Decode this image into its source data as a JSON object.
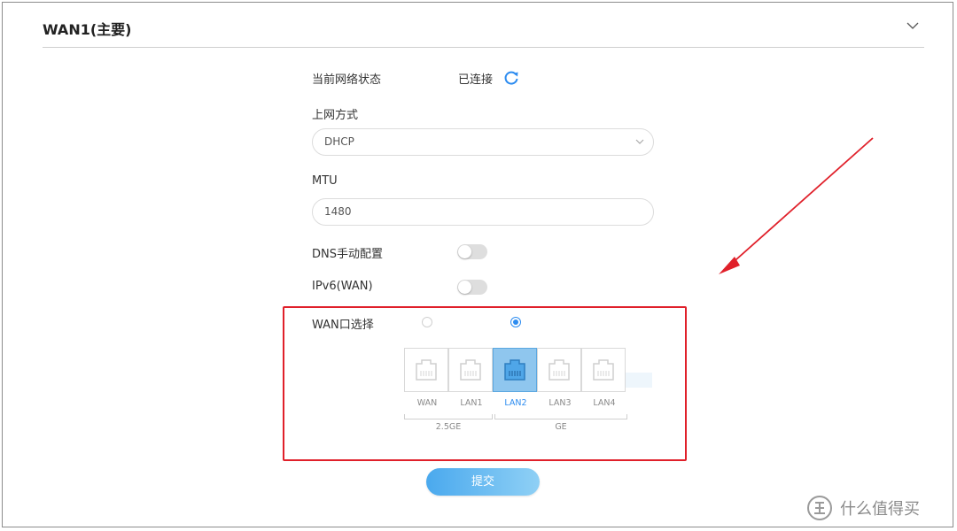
{
  "header": {
    "title": "WAN1(主要)"
  },
  "form": {
    "status_label": "当前网络状态",
    "status_value": "已连接",
    "mode_label": "上网方式",
    "mode_value": "DHCP",
    "mtu_label": "MTU",
    "mtu_value": "1480",
    "dns_label": "DNS手动配置",
    "ipv6_label": "IPv6(WAN)",
    "wan_port_label": "WAN口选择"
  },
  "ports": [
    "WAN",
    "LAN1",
    "LAN2",
    "LAN3",
    "LAN4"
  ],
  "selected_port": "LAN2",
  "port_groups": [
    "2.5GE",
    "GE"
  ],
  "submit_label": "提交",
  "watermark": {
    "text": "什么值得买"
  },
  "colors": {
    "accent": "#2d8cf0",
    "highlight": "#e0202a"
  }
}
